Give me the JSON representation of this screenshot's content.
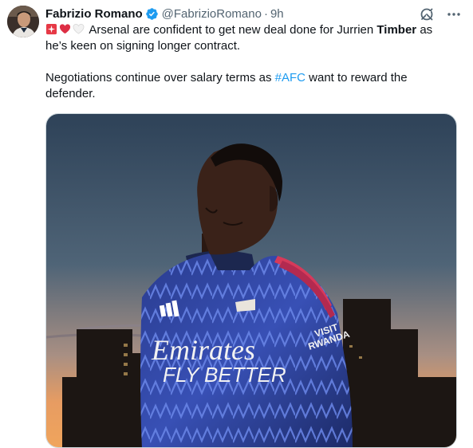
{
  "author": {
    "name": "Fabrizio Romano",
    "handle": "@FabrizioRomano",
    "separator": "·",
    "time": "9h"
  },
  "tweet": {
    "line1_a": "Arsenal are confident to get new deal done for Jurrien ",
    "line1_bold": "Timber",
    "line1_b": " as",
    "line2": "he’s keen on signing longer contract.",
    "line3_a": "Negotiations continue over salary terms as ",
    "hashtag": "#AFC",
    "line3_b": " want to reward the",
    "line4": "defender."
  },
  "media": {
    "shirt_sponsor_line1": "Emirates",
    "shirt_sponsor_line2": "FLY BETTER",
    "sleeve_text_1": "VISIT",
    "sleeve_text_2": "RWANDA"
  },
  "icons": {
    "emoji_1": "siren-icon",
    "emoji_2": "red-heart-icon",
    "emoji_3": "white-heart-icon",
    "verified": "verified-badge-icon",
    "grok": "grok-icon",
    "more": "more-icon"
  },
  "colors": {
    "verified": "#1d9bf0",
    "hashtag": "#1d9bf0",
    "secondary_text": "#536471"
  }
}
